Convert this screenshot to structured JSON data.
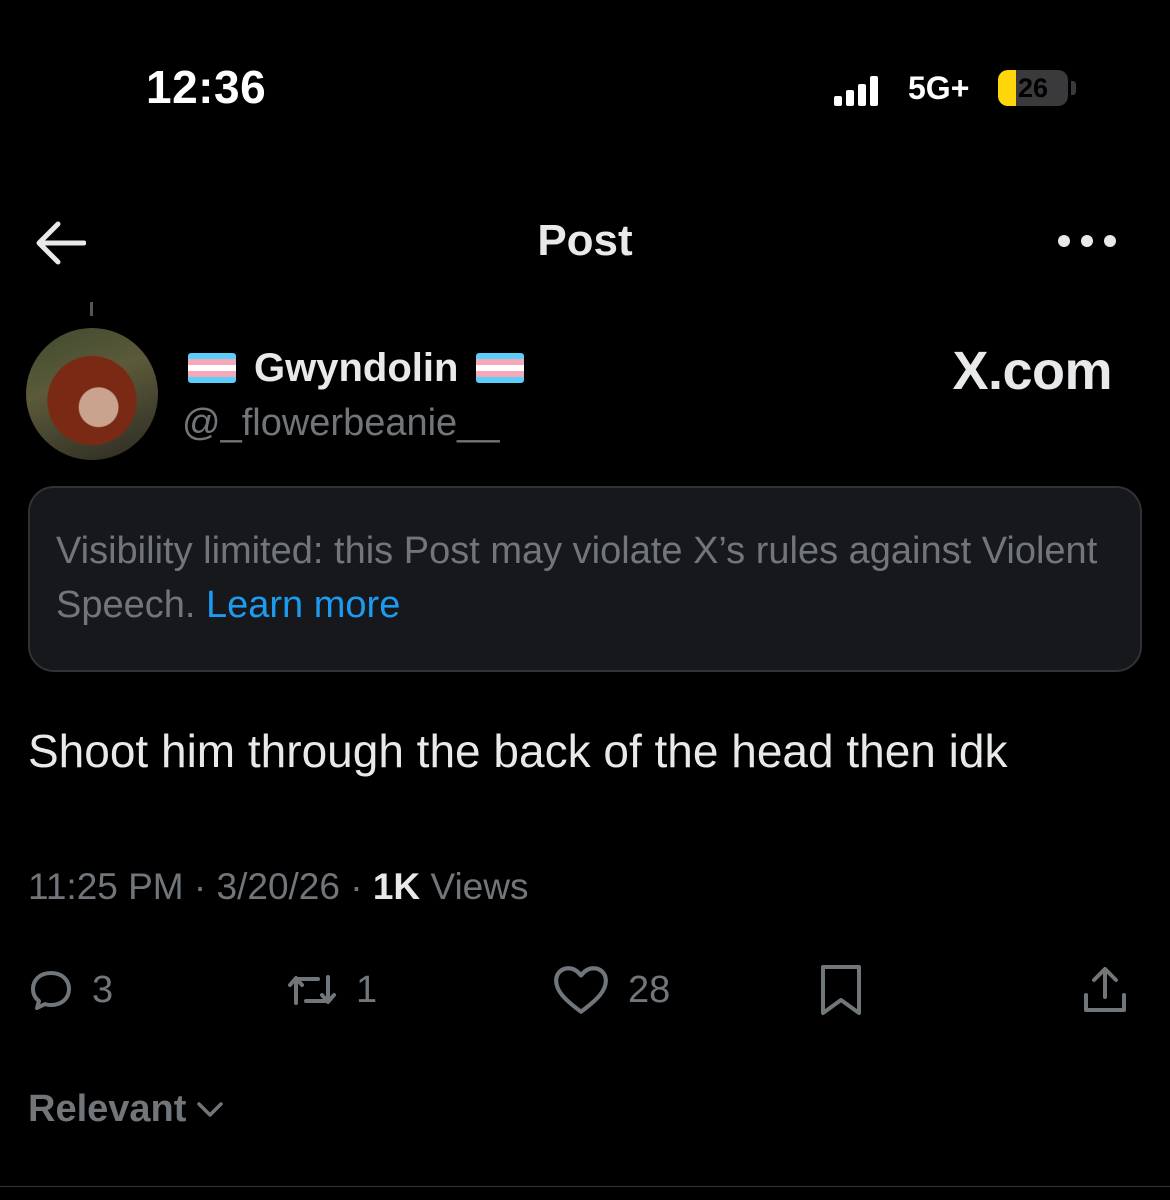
{
  "status_bar": {
    "time": "12:36",
    "network": "5G+",
    "battery": "26",
    "battery_level": 0.26
  },
  "nav": {
    "title": "Post",
    "back_icon": "arrow-left-icon",
    "more_icon": "more-horizontal-icon"
  },
  "author": {
    "display_name": "Gwyndolin",
    "handle": "@_flowerbeanie__",
    "badge": "X.com",
    "flag_colors": [
      "#5bcefa",
      "#f5a9b8",
      "#ffffff",
      "#f5a9b8",
      "#5bcefa"
    ]
  },
  "notice": {
    "text": "Visibility limited: this Post may violate X’s rules against Violent Speech. ",
    "link": "Learn more"
  },
  "post": {
    "text": "Shoot him through the back of the head then idk"
  },
  "meta": {
    "time": "11:25 PM",
    "date": "3/20/26",
    "views_count": "1K",
    "views_label": "Views"
  },
  "actions": {
    "replies": "3",
    "reposts": "1",
    "likes": "28"
  },
  "sort": {
    "label": "Relevant"
  },
  "colors": {
    "background": "#000000",
    "link": "#1d9bf0",
    "muted": "#71767b",
    "text": "#e7e9ea"
  }
}
